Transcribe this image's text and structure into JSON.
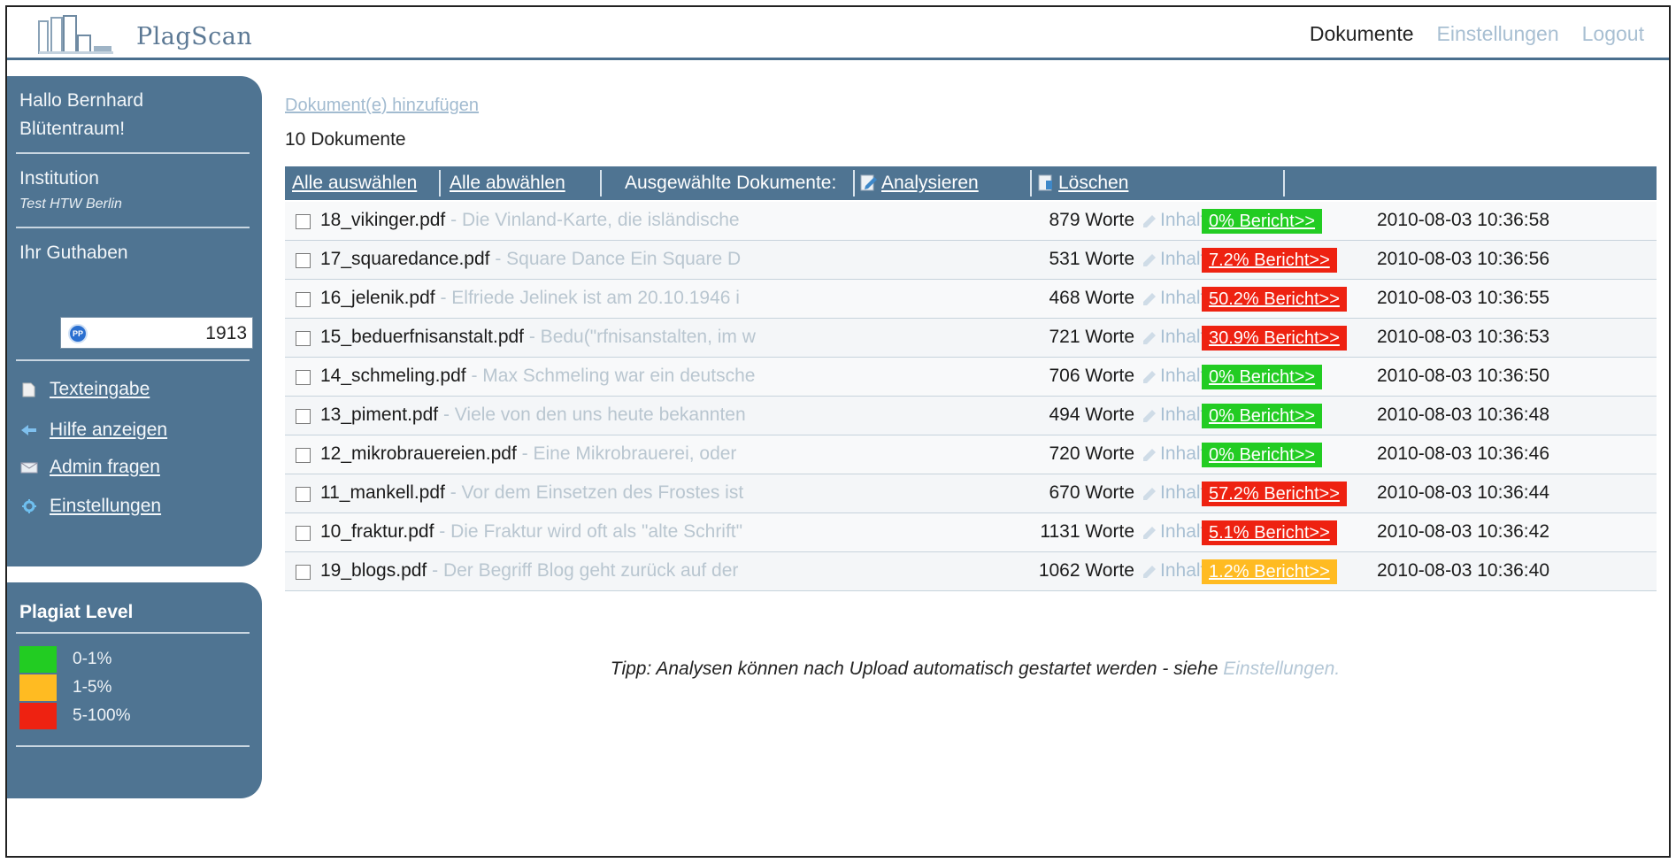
{
  "app": {
    "name": "PlagScan"
  },
  "topnav": {
    "documents": "Dokumente",
    "settings": "Einstellungen",
    "logout": "Logout"
  },
  "sidebar": {
    "greeting_line1": "Hallo Bernhard",
    "greeting_line2": "Blütentraum!",
    "institution_label": "Institution",
    "institution_value": "Test HTW Berlin",
    "credit_label": "Ihr Guthaben",
    "credit_icon_text": "PP",
    "credit_value": "1913",
    "links": {
      "text_input": "Texteingabe",
      "help": "Hilfe anzeigen",
      "ask_admin": "Admin fragen",
      "settings": "Einstellungen"
    }
  },
  "plagiat_level": {
    "title": "Plagiat Level",
    "levels": [
      {
        "label": "0-1%",
        "color": "#22cc22"
      },
      {
        "label": "1-5%",
        "color": "#ffbb22"
      },
      {
        "label": "5-100%",
        "color": "#ee2211"
      }
    ]
  },
  "main": {
    "add_documents": "Dokument(e) hinzufügen",
    "doc_count": "10 Dokumente",
    "toolbar": {
      "select_all": "Alle auswählen",
      "deselect_all": "Alle abwählen",
      "selected_label": "Ausgewählte Dokumente:",
      "analyze": "Analysieren",
      "delete": "Löschen"
    },
    "documents": [
      {
        "file": "18_vikinger.pdf",
        "snippet": "- Die Vinland-Karte, die isländische",
        "words": "879 Worte",
        "inhalt": "Inhalt",
        "report": "0% Bericht>>",
        "color": "#22cc22",
        "date": "2010-08-03 10:36:58"
      },
      {
        "file": "17_squaredance.pdf",
        "snippet": "- Square Dance Ein Square D",
        "words": "531 Worte",
        "inhalt": "Inhalt",
        "report": "7.2% Bericht>>",
        "color": "#ee2211",
        "date": "2010-08-03 10:36:56"
      },
      {
        "file": "16_jelenik.pdf",
        "snippet": "- Elfriede Jelinek ist am 20.10.1946 i",
        "words": "468 Worte",
        "inhalt": "Inhalt",
        "report": "50.2% Bericht>>",
        "color": "#ee2211",
        "date": "2010-08-03 10:36:55"
      },
      {
        "file": "15_beduerfnisanstalt.pdf",
        "snippet": "- Bedu(\"rfnisanstalten, im w",
        "words": "721 Worte",
        "inhalt": "Inhalt",
        "report": "30.9% Bericht>>",
        "color": "#ee2211",
        "date": "2010-08-03 10:36:53"
      },
      {
        "file": "14_schmeling.pdf",
        "snippet": "- Max Schmeling war ein deutsche",
        "words": "706 Worte",
        "inhalt": "Inhalt",
        "report": "0% Bericht>>",
        "color": "#22cc22",
        "date": "2010-08-03 10:36:50"
      },
      {
        "file": "13_piment.pdf",
        "snippet": "- Viele von den uns heute bekannten",
        "words": "494 Worte",
        "inhalt": "Inhalt",
        "report": "0% Bericht>>",
        "color": "#22cc22",
        "date": "2010-08-03 10:36:48"
      },
      {
        "file": "12_mikrobrauereien.pdf",
        "snippet": "- Eine Mikrobrauerei, oder",
        "words": "720 Worte",
        "inhalt": "Inhalt",
        "report": "0% Bericht>>",
        "color": "#22cc22",
        "date": "2010-08-03 10:36:46"
      },
      {
        "file": "11_mankell.pdf",
        "snippet": "- Vor dem Einsetzen des Frostes ist",
        "words": "670 Worte",
        "inhalt": "Inhalt",
        "report": "57.2% Bericht>>",
        "color": "#ee2211",
        "date": "2010-08-03 10:36:44"
      },
      {
        "file": "10_fraktur.pdf",
        "snippet": "- Die Fraktur wird oft als \"alte Schrift\"",
        "words": "1131 Worte",
        "inhalt": "Inhalt",
        "report": "5.1% Bericht>>",
        "color": "#ee2211",
        "date": "2010-08-03 10:36:42"
      },
      {
        "file": "19_blogs.pdf",
        "snippet": "- Der Begriff Blog geht zurück auf der",
        "words": "1062 Worte",
        "inhalt": "Inhalt",
        "report": "1.2% Bericht>>",
        "color": "#ffbb22",
        "date": "2010-08-03 10:36:40"
      }
    ],
    "tip_text": "Tipp: Analysen können nach Upload automatisch gestartet werden - siehe ",
    "tip_link": "Einstellungen",
    "tip_end": "."
  }
}
